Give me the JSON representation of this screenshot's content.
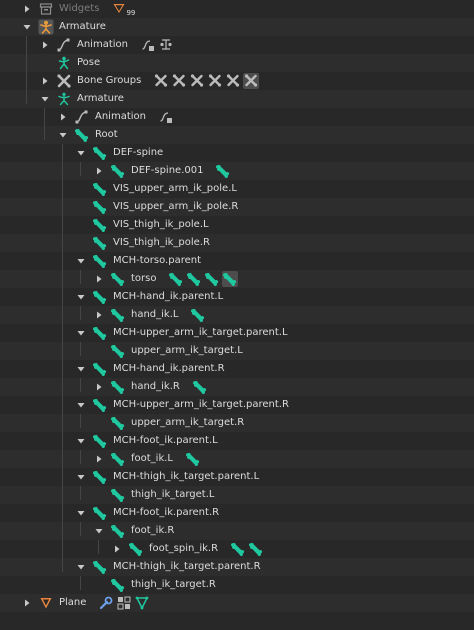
{
  "colors": {
    "bg": "#282828",
    "bone": "#20c8a0",
    "armature_obj": "#e89a3c",
    "mesh": "#e8843c",
    "data_grey": "#bbbbbb",
    "text": "#dcdcdc",
    "text_dim": "#7c7c7c"
  },
  "rows": [
    {
      "label": "Widgets",
      "depth": 0,
      "expand": "right",
      "icon": "collection-icon",
      "dim": true,
      "extras": [
        {
          "icon": "funnel-icon",
          "badge": "99"
        }
      ]
    },
    {
      "label": "Armature",
      "depth": 0,
      "expand": "down",
      "icon": "armature-object-icon"
    },
    {
      "label": "Animation",
      "depth": 1,
      "expand": "right",
      "icon": "animation-icon",
      "extras": [
        {
          "icon": "action-icon"
        },
        {
          "icon": "driver-icon"
        }
      ]
    },
    {
      "label": "Pose",
      "depth": 1,
      "expand": "none",
      "icon": "pose-icon"
    },
    {
      "label": "Bone Groups",
      "depth": 1,
      "expand": "right",
      "icon": "bone-groups-icon",
      "extras": [
        {
          "icon": "group-bone-icon"
        },
        {
          "icon": "group-bone-icon"
        },
        {
          "icon": "group-bone-icon"
        },
        {
          "icon": "group-bone-icon"
        },
        {
          "icon": "group-bone-icon"
        },
        {
          "icon": "group-bone-icon",
          "hl": true
        }
      ]
    },
    {
      "label": "Armature",
      "depth": 1,
      "expand": "down",
      "icon": "armature-data-icon"
    },
    {
      "label": "Animation",
      "depth": 2,
      "expand": "right",
      "icon": "animation-icon",
      "extras": [
        {
          "icon": "action-icon"
        }
      ]
    },
    {
      "label": "Root",
      "depth": 2,
      "expand": "down",
      "icon": "bone-icon"
    },
    {
      "label": "DEF-spine",
      "depth": 3,
      "expand": "down",
      "icon": "bone-icon"
    },
    {
      "label": "DEF-spine.001",
      "depth": 4,
      "expand": "right",
      "icon": "bone-icon",
      "extras": [
        {
          "icon": "bone-icon"
        }
      ]
    },
    {
      "label": "VIS_upper_arm_ik_pole.L",
      "depth": 3,
      "expand": "none",
      "icon": "bone-icon"
    },
    {
      "label": "VIS_upper_arm_ik_pole.R",
      "depth": 3,
      "expand": "none",
      "icon": "bone-icon"
    },
    {
      "label": "VIS_thigh_ik_pole.L",
      "depth": 3,
      "expand": "none",
      "icon": "bone-icon"
    },
    {
      "label": "VIS_thigh_ik_pole.R",
      "depth": 3,
      "expand": "none",
      "icon": "bone-icon"
    },
    {
      "label": "MCH-torso.parent",
      "depth": 3,
      "expand": "down",
      "icon": "bone-icon"
    },
    {
      "label": "torso",
      "depth": 4,
      "expand": "right",
      "icon": "bone-icon",
      "extras": [
        {
          "icon": "bone-icon"
        },
        {
          "icon": "bone-icon"
        },
        {
          "icon": "bone-icon"
        },
        {
          "icon": "bone-icon",
          "hl": true
        }
      ]
    },
    {
      "label": "MCH-hand_ik.parent.L",
      "depth": 3,
      "expand": "down",
      "icon": "bone-icon"
    },
    {
      "label": "hand_ik.L",
      "depth": 4,
      "expand": "right",
      "icon": "bone-icon",
      "extras": [
        {
          "icon": "bone-icon"
        }
      ]
    },
    {
      "label": "MCH-upper_arm_ik_target.parent.L",
      "depth": 3,
      "expand": "down",
      "icon": "bone-icon"
    },
    {
      "label": "upper_arm_ik_target.L",
      "depth": 4,
      "expand": "none",
      "icon": "bone-icon"
    },
    {
      "label": "MCH-hand_ik.parent.R",
      "depth": 3,
      "expand": "down",
      "icon": "bone-icon"
    },
    {
      "label": "hand_ik.R",
      "depth": 4,
      "expand": "right",
      "icon": "bone-icon",
      "extras": [
        {
          "icon": "bone-icon"
        }
      ]
    },
    {
      "label": "MCH-upper_arm_ik_target.parent.R",
      "depth": 3,
      "expand": "down",
      "icon": "bone-icon"
    },
    {
      "label": "upper_arm_ik_target.R",
      "depth": 4,
      "expand": "none",
      "icon": "bone-icon"
    },
    {
      "label": "MCH-foot_ik.parent.L",
      "depth": 3,
      "expand": "down",
      "icon": "bone-icon"
    },
    {
      "label": "foot_ik.L",
      "depth": 4,
      "expand": "right",
      "icon": "bone-icon",
      "extras": [
        {
          "icon": "bone-icon"
        }
      ]
    },
    {
      "label": "MCH-thigh_ik_target.parent.L",
      "depth": 3,
      "expand": "down",
      "icon": "bone-icon"
    },
    {
      "label": "thigh_ik_target.L",
      "depth": 4,
      "expand": "none",
      "icon": "bone-icon"
    },
    {
      "label": "MCH-foot_ik.parent.R",
      "depth": 3,
      "expand": "down",
      "icon": "bone-icon"
    },
    {
      "label": "foot_ik.R",
      "depth": 4,
      "expand": "down",
      "icon": "bone-icon"
    },
    {
      "label": "foot_spin_ik.R",
      "depth": 5,
      "expand": "right",
      "icon": "bone-icon",
      "extras": [
        {
          "icon": "bone-icon"
        },
        {
          "icon": "bone-icon"
        }
      ]
    },
    {
      "label": "MCH-thigh_ik_target.parent.R",
      "depth": 3,
      "expand": "down",
      "icon": "bone-icon"
    },
    {
      "label": "thigh_ik_target.R",
      "depth": 4,
      "expand": "none",
      "icon": "bone-icon"
    },
    {
      "label": "Plane",
      "depth": 0,
      "expand": "right",
      "icon": "mesh-object-icon",
      "extras": [
        {
          "icon": "wrench-icon"
        },
        {
          "icon": "checker-icon"
        },
        {
          "icon": "mesh-data-icon"
        }
      ]
    }
  ]
}
